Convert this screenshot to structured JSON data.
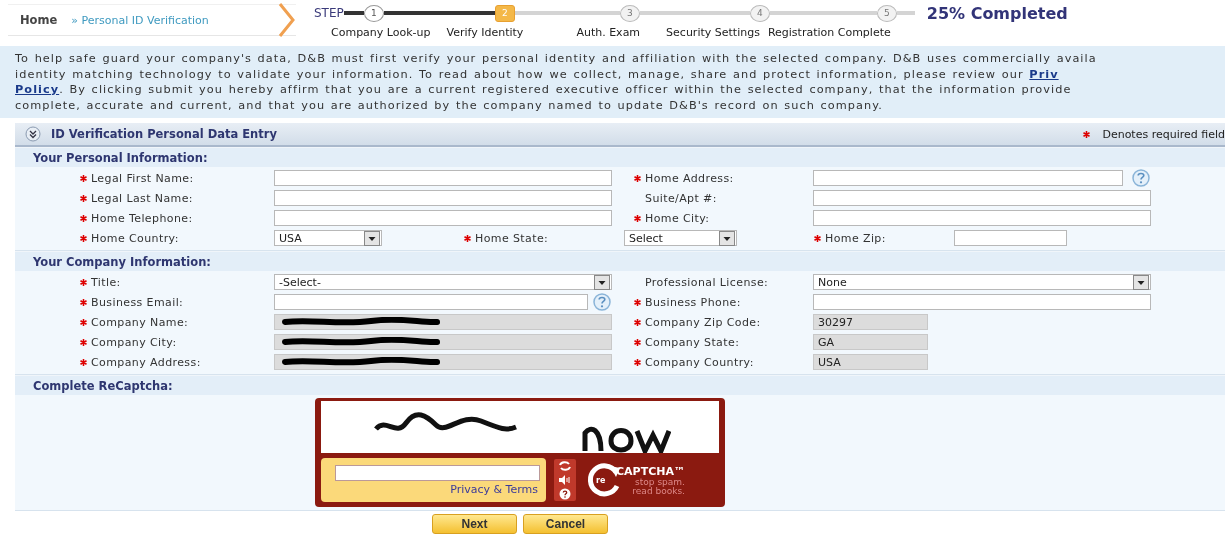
{
  "breadcrumb": {
    "home": "Home",
    "current": "» Personal ID Verification"
  },
  "stepper": {
    "label": "STEP",
    "progress": "25% Completed",
    "steps": [
      {
        "number": "1",
        "label": "Company Look-up",
        "done": true,
        "selected": false
      },
      {
        "number": "2",
        "label": "Verify Identity",
        "done": false,
        "selected": true
      },
      {
        "number": "3",
        "label": "Auth. Exam",
        "done": false,
        "selected": false
      },
      {
        "number": "4",
        "label": "Security Settings",
        "done": false,
        "selected": false
      },
      {
        "number": "5",
        "label": "Registration Complete",
        "done": false,
        "selected": false
      }
    ]
  },
  "intro": {
    "lines": [
      [
        {
          "text": "To help safe guard your company's data, D&B must first verify your personal identity and affiliation with the selected company. D&B uses commercially availa",
          "link": false
        }
      ],
      [
        {
          "text": "identity matching technology to validate your information. To read about how we collect, manage, share and protect information, please review our ",
          "link": false
        },
        {
          "text": "Priv",
          "link": true
        }
      ],
      [
        {
          "text": "Policy",
          "link": true
        },
        {
          "text": ". By clicking submit you hereby affirm that you are a current registered executive officer within the selected company, that the information provide",
          "link": false
        }
      ],
      [
        {
          "text": "complete, accurate and current, and that you are authorized by the company named to update D&B's record on such company.",
          "link": false
        }
      ]
    ]
  },
  "panel": {
    "title": "ID Verification Personal Data Entry",
    "required_note": "Denotes required field"
  },
  "sections": [
    {
      "title": "Your Personal Information:",
      "rows": [
        {
          "kind": "pair",
          "fields": [
            {
              "label": "Legal First Name:",
              "required": true,
              "kind": "text",
              "help": false
            },
            {
              "label": "Home Address:",
              "required": true,
              "kind": "text",
              "help": true
            }
          ]
        },
        {
          "kind": "pair",
          "fields": [
            {
              "label": "Legal Last Name:",
              "required": true,
              "kind": "text",
              "help": false
            },
            {
              "label": "Suite/Apt #:",
              "required": false,
              "kind": "text",
              "help": false
            }
          ]
        },
        {
          "kind": "pair",
          "fields": [
            {
              "label": "Home Telephone:",
              "required": true,
              "kind": "text",
              "help": false
            },
            {
              "label": "Home City:",
              "required": true,
              "kind": "text",
              "help": false
            }
          ]
        },
        {
          "kind": "triple",
          "fields": [
            {
              "label": "Home Country:",
              "required": true,
              "kind": "select",
              "value": "USA",
              "help": false
            },
            {
              "label": "Home State:",
              "required": true,
              "kind": "select",
              "value": "Select",
              "help": false
            },
            {
              "label": "Home Zip:",
              "required": true,
              "kind": "text",
              "help": false
            }
          ]
        }
      ]
    },
    {
      "title": "Your Company Information:",
      "rows": [
        {
          "kind": "pair",
          "fields": [
            {
              "label": "Title:",
              "required": true,
              "kind": "select",
              "value": "-Select-",
              "help": false
            },
            {
              "label": "Professional License:",
              "required": false,
              "kind": "select",
              "value": "None",
              "help": false
            }
          ]
        },
        {
          "kind": "pair",
          "fields": [
            {
              "label": "Business Email:",
              "required": true,
              "kind": "text",
              "help": true
            },
            {
              "label": "Business Phone:",
              "required": true,
              "kind": "text",
              "help": false
            }
          ]
        },
        {
          "kind": "pair",
          "fields": [
            {
              "label": "Company Name:",
              "required": true,
              "kind": "redacted",
              "help": false
            },
            {
              "label": "Company Zip Code:",
              "required": true,
              "kind": "readonly",
              "value": "30297",
              "help": false
            }
          ]
        },
        {
          "kind": "pair",
          "fields": [
            {
              "label": "Company City:",
              "required": true,
              "kind": "redacted",
              "help": false
            },
            {
              "label": "Company State:",
              "required": true,
              "kind": "readonly",
              "value": "GA",
              "help": false
            }
          ]
        },
        {
          "kind": "pair",
          "fields": [
            {
              "label": "Company Address:",
              "required": true,
              "kind": "redacted",
              "help": false
            },
            {
              "label": "Company Country:",
              "required": true,
              "kind": "readonly",
              "value": "USA",
              "help": false
            }
          ]
        }
      ]
    },
    {
      "title": "Complete ReCaptcha:"
    }
  ],
  "captcha": {
    "privacy_link": "Privacy & Terms",
    "logo_prefix": "re",
    "logo": "CAPTCHA™",
    "tagline": [
      "stop spam.",
      "read books."
    ]
  },
  "buttons": [
    "Next",
    "Cancel"
  ]
}
